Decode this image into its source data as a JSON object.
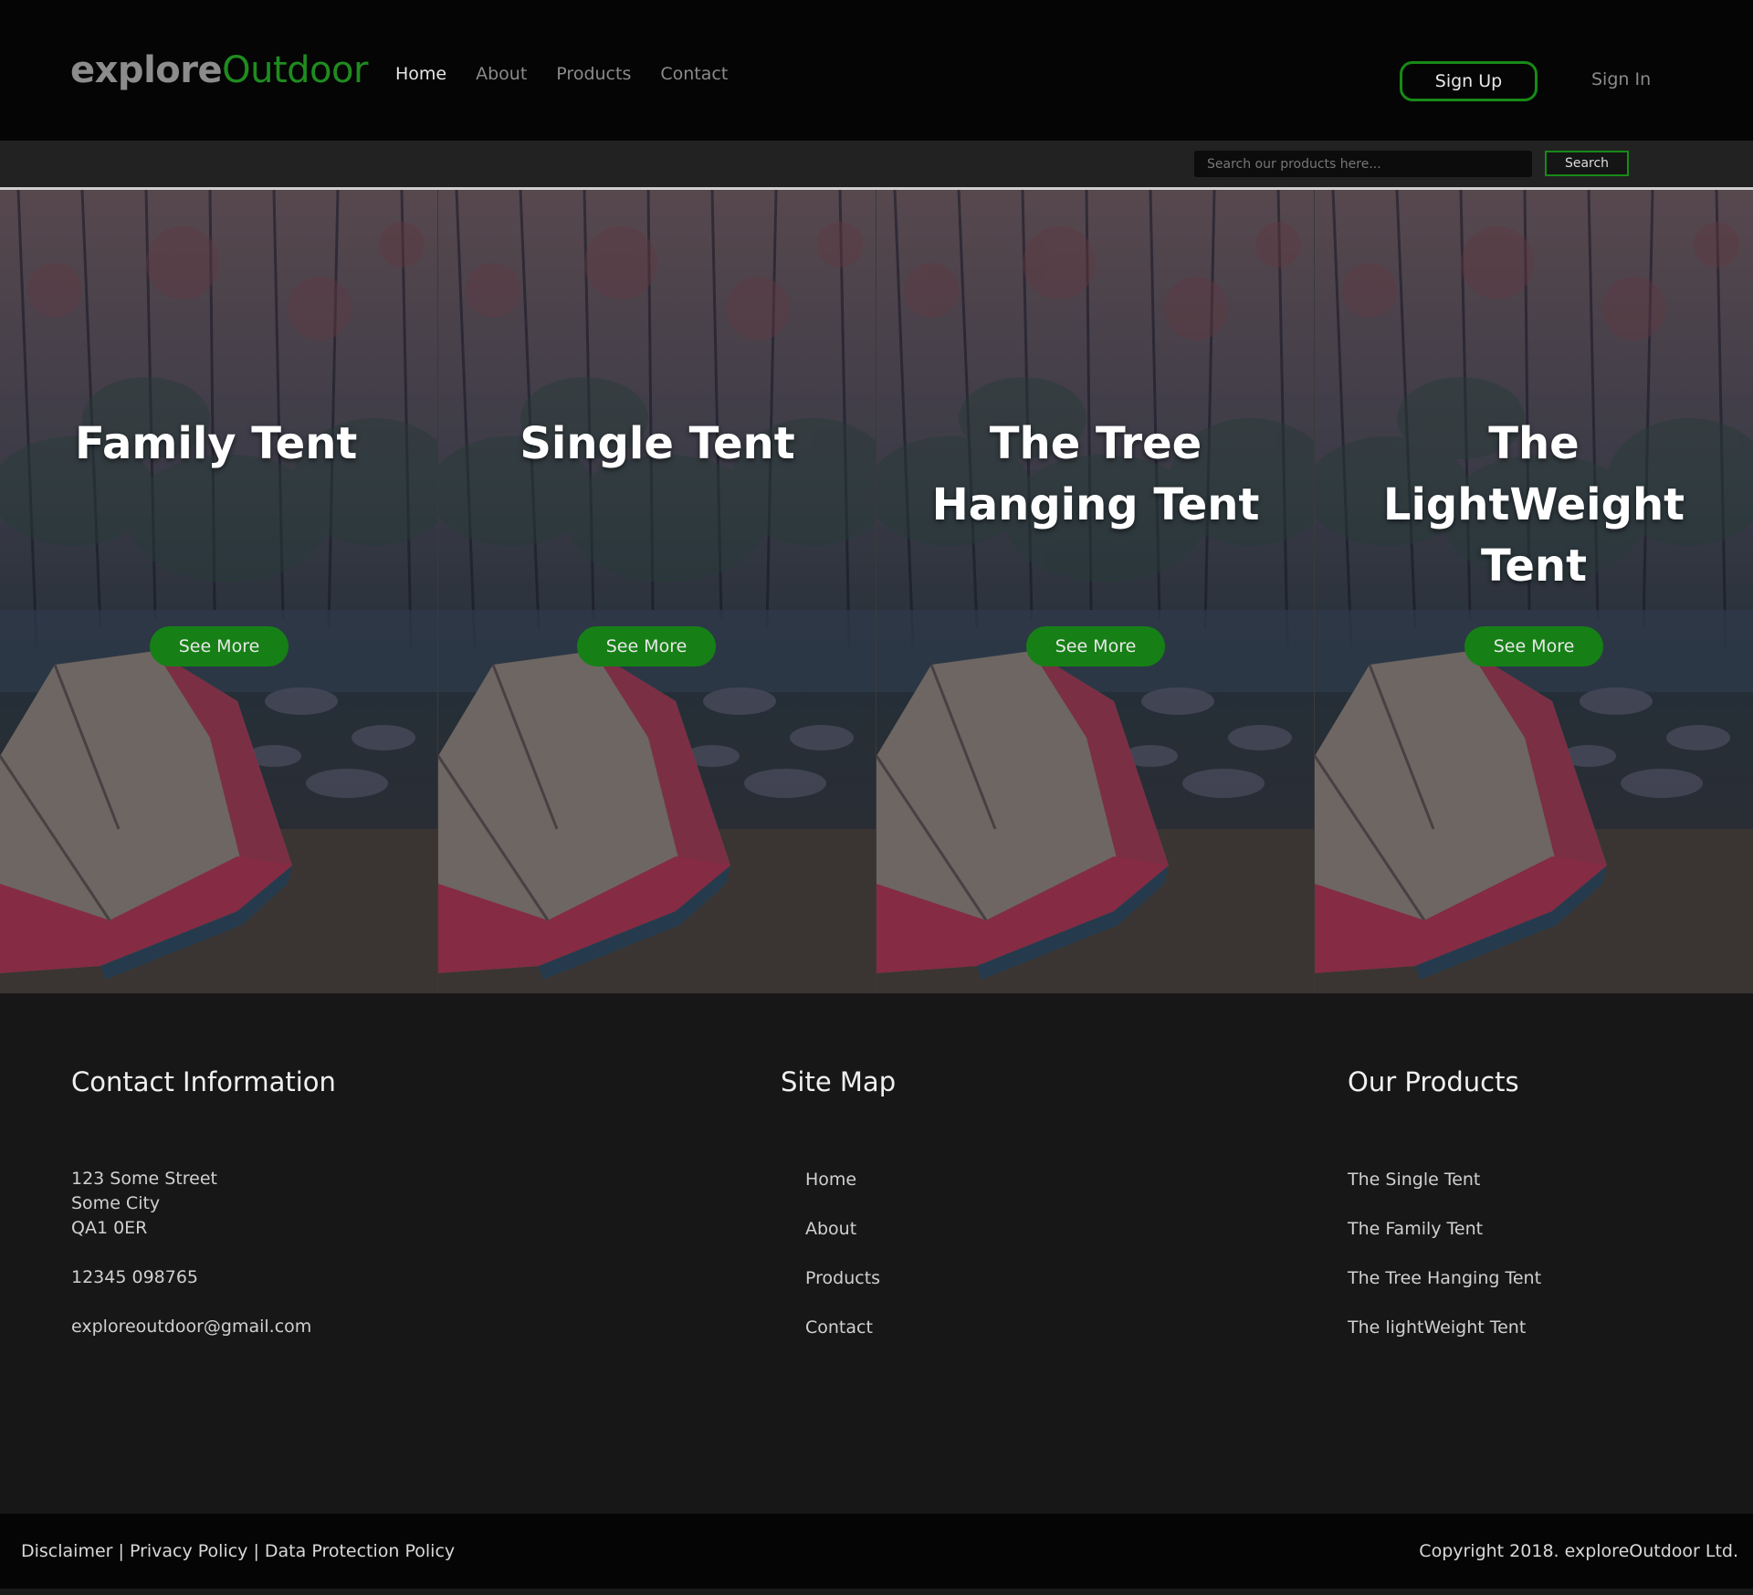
{
  "header": {
    "logo_part1": "explore",
    "logo_part2": "Outdoor",
    "nav": [
      "Home",
      "About",
      "Products",
      "Contact"
    ],
    "active_nav": "Home",
    "signup_label": "Sign Up",
    "signin_label": "Sign In"
  },
  "search": {
    "placeholder": "Search our products here...",
    "button_label": "Search"
  },
  "hero": {
    "panels": [
      {
        "title": "Family Tent",
        "button": "See More"
      },
      {
        "title": "Single Tent",
        "button": "See More"
      },
      {
        "title": "The Tree Hanging Tent",
        "button": "See More"
      },
      {
        "title": "The LightWeight Tent",
        "button": "See More"
      }
    ]
  },
  "footer": {
    "contact": {
      "title": "Contact Information",
      "address_line1": "123 Some Street",
      "address_line2": "Some City",
      "address_line3": "QA1 0ER",
      "phone": "12345 098765",
      "email": "exploreoutdoor@gmail.com"
    },
    "sitemap": {
      "title": "Site Map",
      "links": [
        "Home",
        "About",
        "Products",
        "Contact"
      ]
    },
    "products": {
      "title": "Our Products",
      "links": [
        "The Single Tent",
        "The Family Tent",
        "The Tree Hanging Tent",
        "The lightWeight Tent"
      ]
    }
  },
  "bottom": {
    "left": "Disclaimer | Privacy Policy | Data Protection Policy",
    "right": "Copyright  2018. exploreOutdoor Ltd."
  },
  "colors": {
    "accent": "#178a17",
    "header_bg": "#050505",
    "footer_bg": "#171717"
  }
}
